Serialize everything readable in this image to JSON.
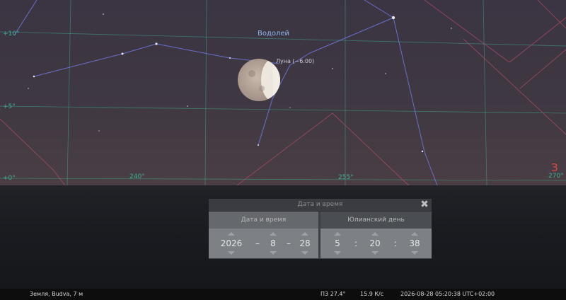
{
  "sky": {
    "constellation": "Водолей",
    "moon_label": "Луна (−6.00)",
    "dec_labels": [
      "+10°",
      "+5°",
      "+0°"
    ],
    "az_labels": [
      "240°",
      "255°",
      "270°"
    ],
    "cardinal": "З"
  },
  "dialog": {
    "title": "Дата и время",
    "close": "✖",
    "tab_date": "Дата и время",
    "tab_jd": "Юлианский день",
    "year": "2026",
    "month": "8",
    "day": "28",
    "hour": "5",
    "minute": "20",
    "second": "38",
    "date_sep": "–",
    "time_sep": ":"
  },
  "status": {
    "location": "Земля, Budva, 7 м",
    "fov": "ПЗ 27.4°",
    "fps": "15.9 К/с",
    "datetime": "2026-08-28 05:20:38 UTC+02:00"
  },
  "colors": {
    "grid_equatorial": "#3fae94",
    "grid_azimuthal": "#b24e63",
    "constellation_lines": "#6f75d8",
    "cardinal": "#d84a3f"
  }
}
